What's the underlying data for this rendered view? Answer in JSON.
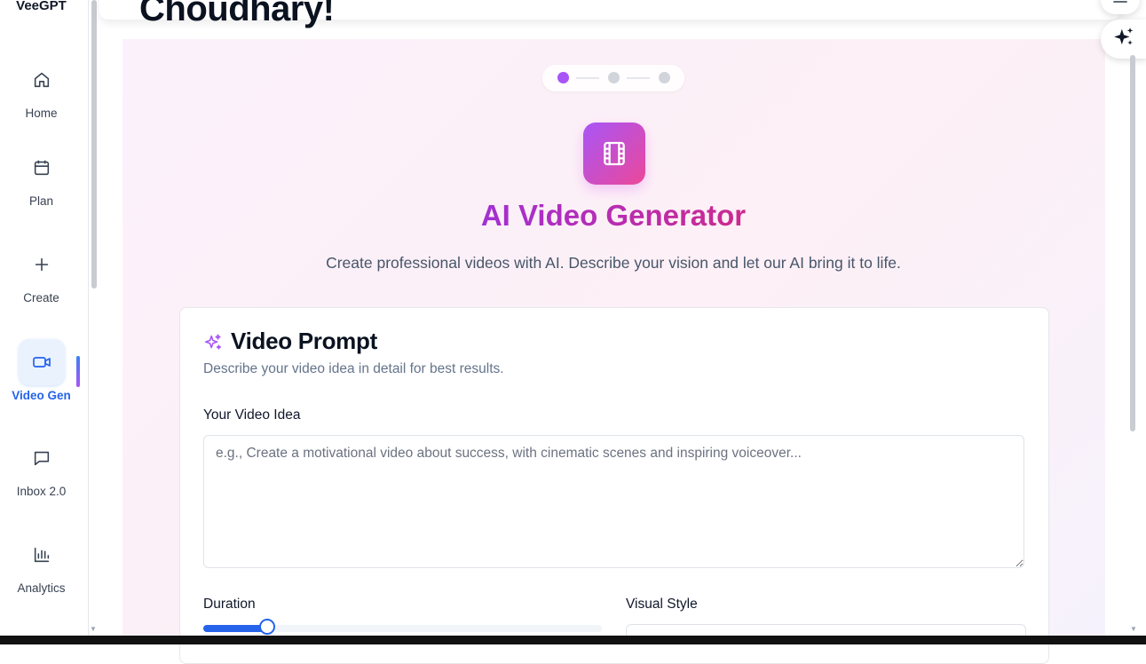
{
  "app": {
    "brand": "VeeGPT"
  },
  "header": {
    "greeting": "Choudhary!"
  },
  "sidebar": {
    "items": [
      {
        "label": "Home",
        "icon": "home-icon",
        "active": false
      },
      {
        "label": "Plan",
        "icon": "calendar-icon",
        "active": false
      },
      {
        "label": "Create",
        "icon": "plus-icon",
        "active": false
      },
      {
        "label": "Video Gen",
        "icon": "video-camera-icon",
        "active": true
      },
      {
        "label": "Inbox 2.0",
        "icon": "chat-icon",
        "active": false
      },
      {
        "label": "Analytics",
        "icon": "bar-chart-icon",
        "active": false
      }
    ]
  },
  "stepper": {
    "total_steps": 3,
    "current_step": 1
  },
  "hero": {
    "icon": "film-icon",
    "title": "AI Video Generator",
    "subtitle": "Create professional videos with AI. Describe your vision and let our AI bring it to life."
  },
  "prompt_card": {
    "icon": "sparkles-icon",
    "title": "Video Prompt",
    "description": "Describe your video idea in detail for best results.",
    "idea_label": "Your Video Idea",
    "idea_value": "",
    "idea_placeholder": "e.g., Create a motivational video about success, with cinematic scenes and inspiring voiceover...",
    "duration_label": "Duration",
    "duration_fraction": 0.16,
    "visual_style_label": "Visual Style"
  },
  "colors": {
    "accent": "#2563eb",
    "purple": "#a855f7",
    "pink": "#ec4899",
    "title_gradient_start": "#9333ea",
    "title_gradient_end": "#db2777"
  },
  "floating": {
    "sparkle_icon": "sparkle-icon",
    "menu_icon": "menu-icon"
  }
}
